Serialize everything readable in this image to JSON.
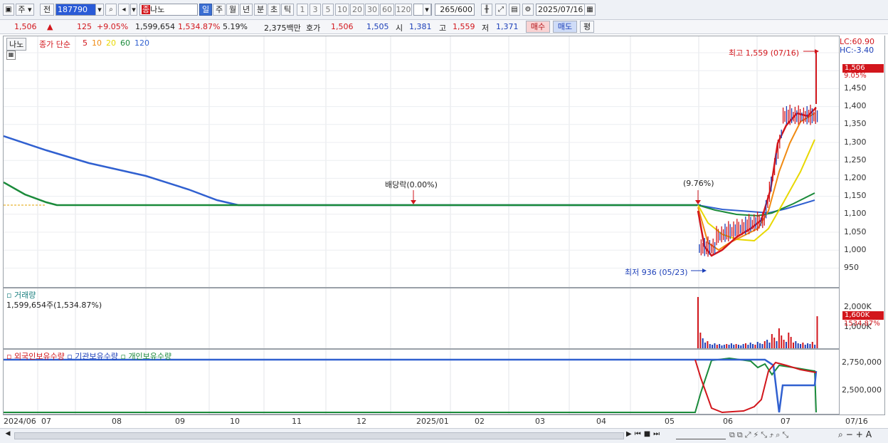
{
  "toolbar": {
    "period": "주",
    "mode": "전",
    "code": "187790",
    "name": "나노",
    "intervals": [
      "일",
      "주",
      "월",
      "년",
      "분",
      "초",
      "틱"
    ],
    "active_interval": "일",
    "minutes": [
      "1",
      "3",
      "5",
      "10",
      "20",
      "30",
      "60",
      "120"
    ],
    "count": "265",
    "count_total": "/600",
    "date": "2025/07/16"
  },
  "quote": {
    "price": "1,506",
    "arrow": "▲",
    "change": "125",
    "change_pct": "+9.05%",
    "volume": "1,599,654",
    "volume_pct": "1,534.87%",
    "turnover_pct": "5.19%",
    "amount": "2,375백만",
    "hoga_label": "호가",
    "ask": "1,506",
    "bid": "1,505",
    "open_label": "시",
    "open": "1,381",
    "high_label": "고",
    "high": "1,559",
    "low_label": "저",
    "low": "1,371",
    "buy_btn": "매수",
    "sell_btn": "매도",
    "eval_btn": "평"
  },
  "price_pane": {
    "name": "나노",
    "ma_title": "종가 단순",
    "ma_periods": [
      "5",
      "10",
      "20",
      "60",
      "120"
    ],
    "ma_colors": [
      "#d2161c",
      "#f08a12",
      "#e8d800",
      "#1a8a3a",
      "#3060d0"
    ],
    "lc": "LC:60.90",
    "hc": "HC:-3.40",
    "high_note": "최고 1,559 (07/16)",
    "low_note": "최저 936 (05/23)",
    "dividend_note": "배당락(0.00%)",
    "pct_note": "(9.76%)",
    "price_tag": "1,506",
    "pct_tag": "9.05%",
    "ticks": [
      "1,450",
      "1,400",
      "1,350",
      "1,300",
      "1,250",
      "1,200",
      "1,150",
      "1,100",
      "1,050",
      "1,000",
      "950"
    ]
  },
  "volume_pane": {
    "title": "거래량",
    "value": "1,599,654주(1,534.87%)",
    "tick": "2,000K",
    "tag": "1,600K",
    "tag2": "1534.87%",
    "tick2": "1,000K"
  },
  "holding_pane": {
    "legend": [
      "외국인보유수량",
      "기관보유수량",
      "개인보유수량"
    ],
    "ticks": [
      "2,750,000",
      "2,500,000"
    ]
  },
  "xaxis": {
    "labels": [
      "2024/06",
      "07",
      "08",
      "09",
      "10",
      "11",
      "12",
      "2025/01",
      "02",
      "03",
      "04",
      "05",
      "06",
      "07"
    ],
    "end_label": "07/16"
  }
}
